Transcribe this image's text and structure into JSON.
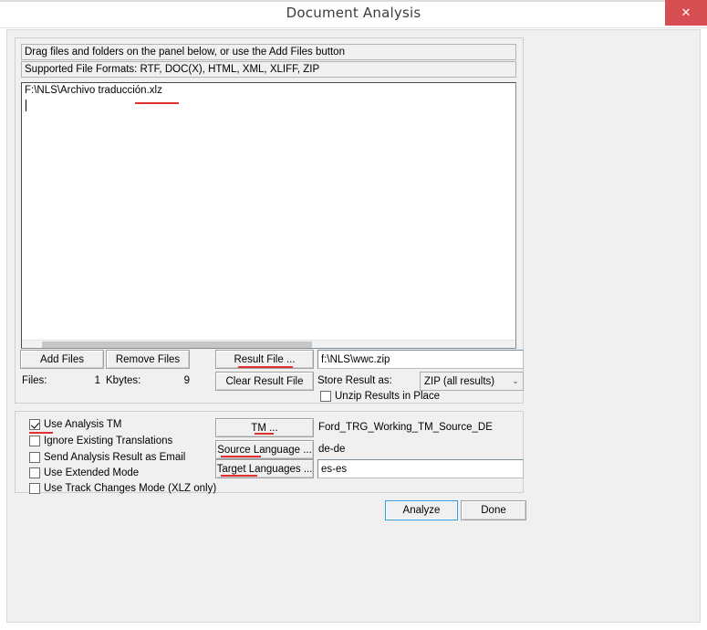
{
  "window": {
    "title": "Document Analysis",
    "close_label": "✕"
  },
  "files_panel": {
    "hint_bar": "Drag files and folders on the panel below, or use the Add Files button",
    "formats_bar": "Supported File Formats:  RTF, DOC(X), HTML, XML, XLIFF, ZIP",
    "file_list": [
      "F:\\NLS\\Archivo traducción.xlz"
    ]
  },
  "buttons": {
    "add_files": "Add Files",
    "remove_files": "Remove Files",
    "result_file": "Result File ...",
    "clear_result_file": "Clear Result File",
    "tm": "TM ...",
    "source_language": "Source Language ...",
    "target_languages": "Target Languages ...",
    "analyze": "Analyze",
    "done": "Done"
  },
  "stats": {
    "files_label": "Files:",
    "files_value": "1",
    "kbytes_label": "Kbytes:",
    "kbytes_value": "9"
  },
  "result": {
    "result_file_value": "f:\\NLS\\wwc.zip",
    "store_result_label": "Store Result as:",
    "store_result_selected": "ZIP (all results)",
    "store_result_options": [
      "ZIP (all results)"
    ],
    "unzip_label": "Unzip Results in Place",
    "unzip_checked": false,
    "combo_arrow": "⌄"
  },
  "options": {
    "checkboxes": [
      {
        "label": "Use Analysis TM",
        "checked": true
      },
      {
        "label": "Ignore Existing Translations",
        "checked": false
      },
      {
        "label": "Send Analysis Result as Email",
        "checked": false
      },
      {
        "label": "Use Extended Mode",
        "checked": false
      },
      {
        "label": "Use Track Changes Mode (XLZ only)",
        "checked": false
      }
    ]
  },
  "tm_settings": {
    "tm_name": "Ford_TRG_Working_TM_Source_DE",
    "source_language_value": "de-de",
    "target_languages_value": "es-es"
  },
  "annotations": {
    "color": "#e03030",
    "underlined_items": [
      "file-extension-xlz",
      "result-file-button",
      "use-analysis-tm-checkbox",
      "tm-button",
      "source-language-button",
      "target-languages-button"
    ]
  }
}
